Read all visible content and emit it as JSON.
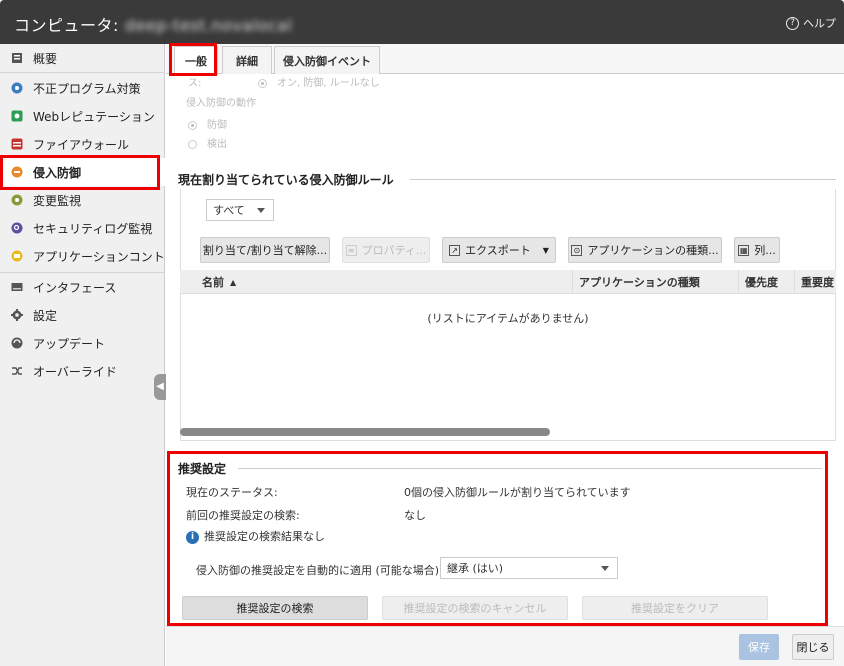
{
  "window": {
    "title_prefix": "コンピュータ:",
    "hostname": "deep-test.novalocal",
    "help_label": "ヘルプ"
  },
  "sidebar": {
    "items": [
      {
        "label": "概要",
        "icon": "overview-icon"
      },
      {
        "label": "不正プログラム対策",
        "icon": "antimalware-icon"
      },
      {
        "label": "Webレピュテーション",
        "icon": "web-reputation-icon"
      },
      {
        "label": "ファイアウォール",
        "icon": "firewall-icon"
      },
      {
        "label": "侵入防御",
        "icon": "intrusion-prevention-icon"
      },
      {
        "label": "変更監視",
        "icon": "integrity-monitoring-icon"
      },
      {
        "label": "セキュリティログ監視",
        "icon": "log-inspection-icon"
      },
      {
        "label": "アプリケーションコント",
        "icon": "application-control-icon"
      },
      {
        "label": "インタフェース",
        "icon": "interfaces-icon"
      },
      {
        "label": "設定",
        "icon": "gear-icon"
      },
      {
        "label": "アップデート",
        "icon": "updates-icon"
      },
      {
        "label": "オーバーライド",
        "icon": "overrides-icon"
      }
    ],
    "active_index": 4
  },
  "tabs": [
    "一般",
    "詳細",
    "侵入防御イベント"
  ],
  "general": {
    "status_partial": "ス:",
    "status_value_partial": "オン, 防御, ルールなし",
    "behavior_label": "侵入防御の動作",
    "option_prevent": "防御",
    "option_detect": "検出"
  },
  "assigned_rules": {
    "title": "現在割り当てられている侵入防御ルール",
    "filter_value": "すべて",
    "toolbar": {
      "assign": "割り当て/割り当て解除...",
      "properties": "プロパティ...",
      "export": "エクスポート",
      "app_types": "アプリケーションの種類...",
      "columns": "列..."
    },
    "columns": [
      "名前",
      "アプリケーションの種類",
      "優先度",
      "重要度"
    ],
    "empty_message": "(リストにアイテムがありません)"
  },
  "recommendations": {
    "title": "推奨設定",
    "current_status_label": "現在のステータス:",
    "current_status_value": "0個の侵入防御ルールが割り当てられています",
    "last_scan_label": "前回の推奨設定の検索:",
    "last_scan_value": "なし",
    "no_results": "推奨設定の検索結果なし",
    "auto_apply_label": "侵入防御の推奨設定を自動的に適用 (可能な場合):",
    "auto_apply_value": "継承 (はい)",
    "scan_button": "推奨設定の検索",
    "cancel_button": "推奨設定の検索のキャンセル",
    "clear_button": "推奨設定をクリア"
  },
  "footer": {
    "save": "保存",
    "close": "閉じる"
  }
}
